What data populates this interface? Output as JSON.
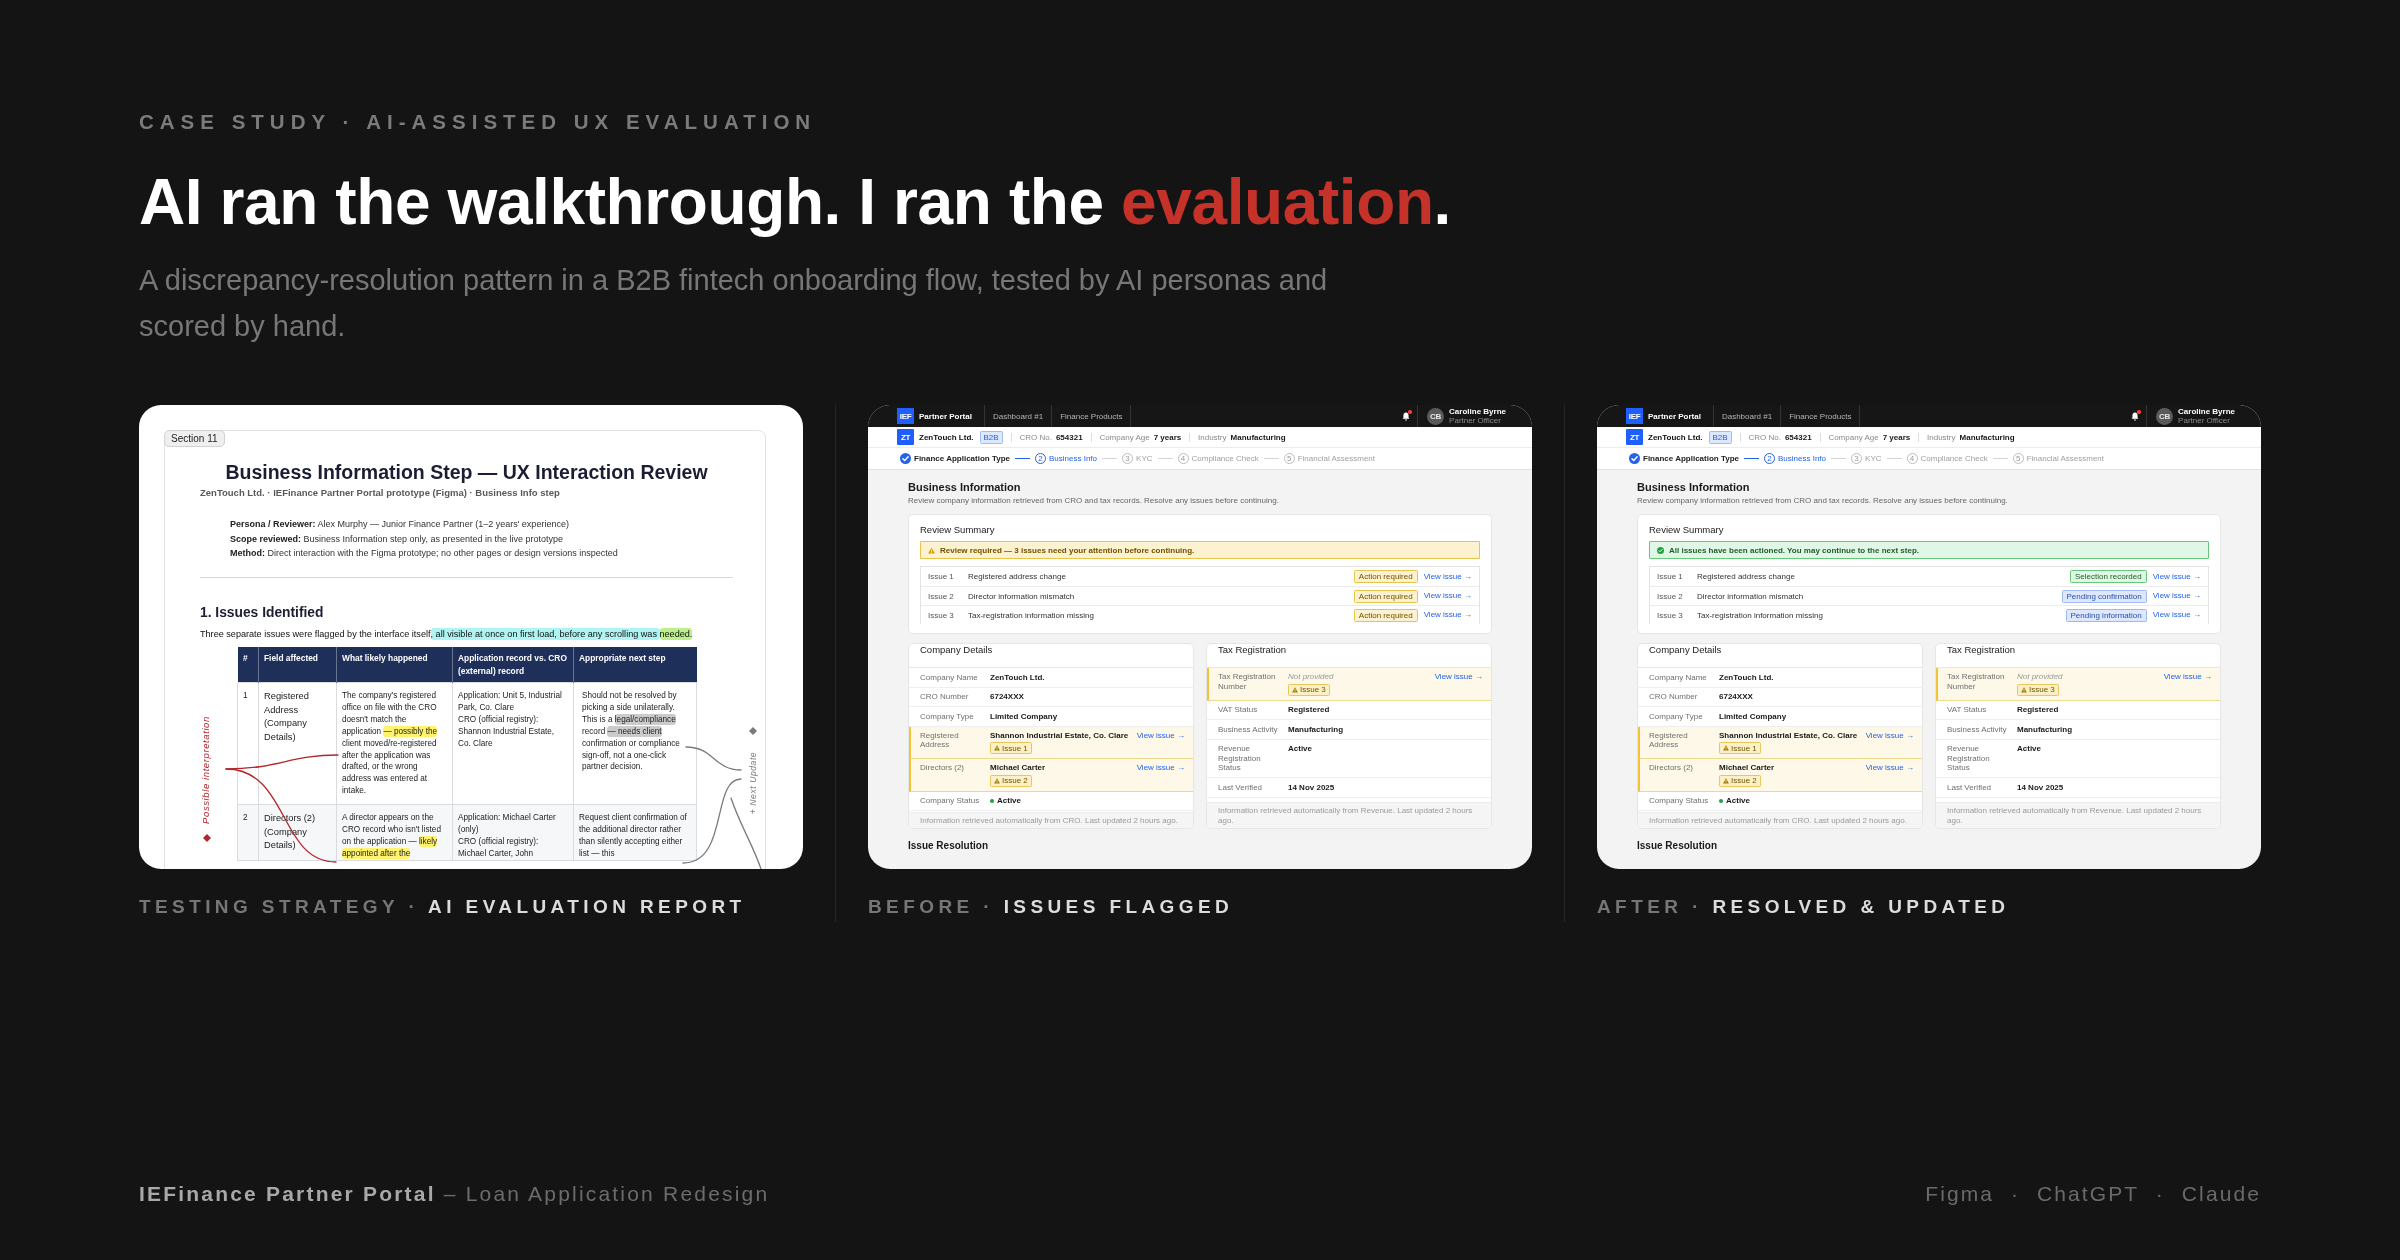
{
  "eyebrow": "CASE STUDY · AI-ASSISTED UX EVALUATION",
  "headline": [
    {
      "text": "AI ran the walkthrough. I ran the ",
      "emphasis": false
    },
    {
      "text": "evaluation",
      "emphasis": true
    },
    {
      "text": ".",
      "emphasis": false
    }
  ],
  "subtitle": "A discrepancy-resolution pattern in a B2B fintech onboarding flow, tested by AI personas and scored by hand.",
  "panels": [
    {
      "kind": "report",
      "caption": [
        {
          "text": "TESTING STRATEGY ·",
          "emphasis": false
        },
        {
          "text": "AI EVALUATION REPORT",
          "emphasis": true
        }
      ],
      "report": {
        "section": "Section 11",
        "title": "Business Information Step — UX Interaction Review",
        "subtitle": "ZenTouch Ltd. · IEFinance Partner Portal prototype (Figma) · Business Info step",
        "meta": [
          {
            "label": "Persona / Reviewer:",
            "value": "Alex Murphy — Junior Finance Partner (1–2 years' experience)"
          },
          {
            "label": "Scope reviewed:",
            "value": "Business Information step only, as presented in the live prototype"
          },
          {
            "label": "Method:",
            "value": "Direct interaction with the Figma prototype; no other pages or design versions inspected"
          }
        ],
        "heading": "1. Issues Identified",
        "intro": [
          {
            "text": "Three separate issues were flagged by the interface itself"
          },
          {
            "text": ", all visible at once on first load, before any scrolling was ",
            "color": "#aef4f2"
          },
          {
            "text": "needed.",
            "color": "#bcf08a"
          }
        ],
        "table": {
          "columns": [
            "#",
            "Field affected",
            "What likely happened",
            "Application record vs. CRO (external) record",
            "Appropriate next step"
          ],
          "rows": [
            {
              "cells": [
                [
                  "1"
                ],
                [
                  "Registered Address (Company Details)"
                ],
                [
                  [
                    {
                      "text": "The company's registered office on file with the CRO doesn't match the application "
                    },
                    {
                      "text": "— possibly the",
                      "color": "#fff36e"
                    },
                    {
                      "text": " client moved/re-registered after the application was drafted, or the wrong address was entered at intake."
                    }
                  ]
                ],
                [
                  "Application: Unit 5, Industrial Park, Co. Clare",
                  "CRO (official registry): Shannon Industrial Estate, Co. Clare"
                ],
                [
                  [
                    {
                      "text": "Should not be resolved by picking a side unilaterally. This is a "
                    },
                    {
                      "text": "legal/compliance",
                      "color": "#cbcbcb"
                    },
                    {
                      "text": " record "
                    },
                    {
                      "text": "— needs client",
                      "color": "#cbcbcb"
                    },
                    {
                      "text": " confirmation or compliance sign-off, not a one-click partner decision."
                    }
                  ]
                ]
              ]
            },
            {
              "cells": [
                [
                  "2"
                ],
                [
                  "Directors (2) (Company Details)"
                ],
                [
                  [
                    {
                      "text": "A director appears on the CRO record who isn't listed on the application — "
                    },
                    {
                      "text": "likely appointed after the",
                      "color": "#fff36e"
                    }
                  ]
                ],
                [
                  "Application: Michael Carter (only)",
                  "CRO (official registry): Michael Carter, John"
                ],
                [
                  "Request client confirmation of the additional director rather than silently accepting either list — this"
                ]
              ]
            }
          ]
        },
        "annotations": [
          {
            "text": "Possible interpretation",
            "color": "#b3262a"
          },
          {
            "text": "+ Next Update",
            "color": "#7a7a7a"
          }
        ]
      }
    },
    {
      "kind": "portal",
      "caption": [
        {
          "text": "BEFORE ·",
          "emphasis": false
        },
        {
          "text": "ISSUES FLAGGED",
          "emphasis": true
        }
      ],
      "portal": {
        "nav": {
          "logo": "IEF",
          "brand": "Partner Portal",
          "links": [
            "Dashboard #1",
            "Finance Products"
          ],
          "unread": true,
          "user": {
            "initials": "CB",
            "name": "Caroline Byrne",
            "role": "Partner Officer"
          }
        },
        "company": {
          "logo": "ZT",
          "name": "ZenTouch Ltd.",
          "badge": "B2B",
          "facts": [
            {
              "label": "CRO No.",
              "value": "654321"
            },
            {
              "label": "Company Age",
              "value": "7 years"
            },
            {
              "label": "Industry",
              "value": "Manufacturing"
            }
          ]
        },
        "steps": [
          {
            "label": "Finance Application Type",
            "done": true,
            "selected": false
          },
          {
            "number": "2",
            "label": "Business Info",
            "done": false,
            "selected": true
          },
          {
            "number": "3",
            "label": "KYC",
            "done": false,
            "selected": false
          },
          {
            "number": "4",
            "label": "Compliance Check",
            "done": false,
            "selected": false
          },
          {
            "number": "5",
            "label": "Financial Assessment",
            "done": false,
            "selected": false
          }
        ],
        "title": "Business Information",
        "description": "Review company information retrieved from CRO and tax records. Resolve any issues before continuing.",
        "summary": {
          "title": "Review Summary",
          "alert": {
            "resolved": false,
            "text": "Review required — 3 issues need your attention before continuing."
          },
          "issues": [
            {
              "number": "Issue 1",
              "title": "Registered address change",
              "status": "Action required",
              "kind": "warning",
              "link": "View issue →"
            },
            {
              "number": "Issue 2",
              "title": "Director information mismatch",
              "status": "Action required",
              "kind": "warning",
              "link": "View issue →"
            },
            {
              "number": "Issue 3",
              "title": "Tax-registration information missing",
              "status": "Action required",
              "kind": "warning",
              "link": "View issue →"
            }
          ]
        },
        "sections": [
          {
            "title": "Company Details",
            "rows": [
              {
                "label": "Company Name",
                "value": "ZenTouch Ltd.",
                "flagged": false
              },
              {
                "label": "CRO Number",
                "value": "6724XXX",
                "flagged": false
              },
              {
                "label": "Company Type",
                "value": "Limited Company",
                "flagged": false
              },
              {
                "label": "Registered Address",
                "value": "Shannon Industrial Estate, Co. Clare",
                "flagged": true,
                "flag": "Issue 1",
                "link": "View issue →"
              },
              {
                "label": "Directors (2)",
                "value": "Michael Carter",
                "flagged": true,
                "flag": "Issue 2",
                "link": "View issue →"
              },
              {
                "label": "Company Status",
                "value": "Active",
                "color": "#22a045",
                "flagged": false
              }
            ],
            "note": "Information retrieved automatically from CRO. Last updated 2 hours ago."
          },
          {
            "title": "Tax Registration",
            "rows": [
              {
                "label": "Tax Registration Number",
                "placeholder": "Not provided",
                "flagged": true,
                "flag": "Issue 3",
                "link": "View issue →"
              },
              {
                "label": "VAT Status",
                "value": "Registered",
                "flagged": false
              },
              {
                "label": "Business Activity",
                "value": "Manufacturing",
                "flagged": false
              },
              {
                "label": "Revenue Registration Status",
                "value": "Active",
                "flagged": false
              },
              {
                "label": "Last Verified",
                "value": "14 Nov 2025",
                "flagged": false
              }
            ],
            "note": "Information retrieved automatically from Revenue. Last updated 2 hours ago."
          }
        ],
        "next_section": "Issue Resolution"
      }
    },
    {
      "kind": "portal",
      "caption": [
        {
          "text": "AFTER ·",
          "emphasis": false
        },
        {
          "text": "RESOLVED & UPDATED",
          "emphasis": true
        }
      ],
      "portal": {
        "nav": {
          "logo": "IEF",
          "brand": "Partner Portal",
          "links": [
            "Dashboard #1",
            "Finance Products"
          ],
          "unread": true,
          "user": {
            "initials": "CB",
            "name": "Caroline Byrne",
            "role": "Partner Officer"
          }
        },
        "company": {
          "logo": "ZT",
          "name": "ZenTouch Ltd.",
          "badge": "B2B",
          "facts": [
            {
              "label": "CRO No.",
              "value": "654321"
            },
            {
              "label": "Company Age",
              "value": "7 years"
            },
            {
              "label": "Industry",
              "value": "Manufacturing"
            }
          ]
        },
        "steps": [
          {
            "label": "Finance Application Type",
            "done": true,
            "selected": false
          },
          {
            "number": "2",
            "label": "Business Info",
            "done": false,
            "selected": true
          },
          {
            "number": "3",
            "label": "KYC",
            "done": false,
            "selected": false
          },
          {
            "number": "4",
            "label": "Compliance Check",
            "done": false,
            "selected": false
          },
          {
            "number": "5",
            "label": "Financial Assessment",
            "done": false,
            "selected": false
          }
        ],
        "title": "Business Information",
        "description": "Review company information retrieved from CRO and tax records. Resolve any issues before continuing.",
        "summary": {
          "title": "Review Summary",
          "alert": {
            "resolved": true,
            "text": "All issues have been actioned. You may continue to the next step."
          },
          "issues": [
            {
              "number": "Issue 1",
              "title": "Registered address change",
              "status": "Selection recorded",
              "kind": "success",
              "link": "View issue →"
            },
            {
              "number": "Issue 2",
              "title": "Director information mismatch",
              "status": "Pending confirmation",
              "kind": "info",
              "link": "View issue →"
            },
            {
              "number": "Issue 3",
              "title": "Tax-registration information missing",
              "status": "Pending information",
              "kind": "info",
              "link": "View issue →"
            }
          ]
        },
        "sections": [
          {
            "title": "Company Details",
            "rows": [
              {
                "label": "Company Name",
                "value": "ZenTouch Ltd.",
                "flagged": false
              },
              {
                "label": "CRO Number",
                "value": "6724XXX",
                "flagged": false
              },
              {
                "label": "Company Type",
                "value": "Limited Company",
                "flagged": false
              },
              {
                "label": "Registered Address",
                "value": "Shannon Industrial Estate, Co. Clare",
                "flagged": true,
                "flag": "Issue 1",
                "link": "View issue →"
              },
              {
                "label": "Directors (2)",
                "value": "Michael Carter",
                "flagged": true,
                "flag": "Issue 2",
                "link": "View issue →"
              },
              {
                "label": "Company Status",
                "value": "Active",
                "color": "#22a045",
                "flagged": false
              }
            ],
            "note": "Information retrieved automatically from CRO. Last updated 2 hours ago."
          },
          {
            "title": "Tax Registration",
            "rows": [
              {
                "label": "Tax Registration Number",
                "placeholder": "Not provided",
                "flagged": true,
                "flag": "Issue 3",
                "link": "View issue →"
              },
              {
                "label": "VAT Status",
                "value": "Registered",
                "flagged": false
              },
              {
                "label": "Business Activity",
                "value": "Manufacturing",
                "flagged": false
              },
              {
                "label": "Revenue Registration Status",
                "value": "Active",
                "flagged": false
              },
              {
                "label": "Last Verified",
                "value": "14 Nov 2025",
                "flagged": false
              }
            ],
            "note": "Information retrieved automatically from Revenue. Last updated 2 hours ago."
          }
        ],
        "next_section": "Issue Resolution"
      }
    }
  ],
  "footer": {
    "project": "**IEFinance Partner Portal** – Loan Application Redesign",
    "tools": "Figma · ChatGPT · Claude"
  }
}
